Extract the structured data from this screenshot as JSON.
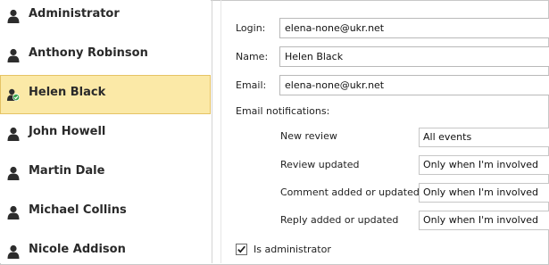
{
  "users": [
    {
      "name": "Administrator",
      "selected": false,
      "icon": "user-icon"
    },
    {
      "name": "Anthony Robinson",
      "selected": false,
      "icon": "user-icon"
    },
    {
      "name": "Helen Black",
      "selected": true,
      "icon": "user-check-icon"
    },
    {
      "name": "John Howell",
      "selected": false,
      "icon": "user-icon"
    },
    {
      "name": "Martin Dale",
      "selected": false,
      "icon": "user-icon"
    },
    {
      "name": "Michael Collins",
      "selected": false,
      "icon": "user-icon"
    },
    {
      "name": "Nicole Addison",
      "selected": false,
      "icon": "user-icon"
    }
  ],
  "form": {
    "login_label": "Login:",
    "login_value": "elena-none@ukr.net",
    "name_label": "Name:",
    "name_value": "Helen Black",
    "email_label": "Email:",
    "email_value": "elena-none@ukr.net",
    "notifications_label": "Email notifications:",
    "notifications": [
      {
        "label": "New review",
        "value": "All events"
      },
      {
        "label": "Review updated",
        "value": "Only when I'm involved"
      },
      {
        "label": "Comment added or updated",
        "value": "Only when I'm involved"
      },
      {
        "label": "Reply added or updated",
        "value": "Only when I'm involved"
      }
    ],
    "is_admin_label": "Is administrator",
    "is_admin_checked": true
  },
  "colors": {
    "selected_bg": "#fbe9a7",
    "selected_border": "#e5c365",
    "check_badge": "#3aa34a"
  }
}
